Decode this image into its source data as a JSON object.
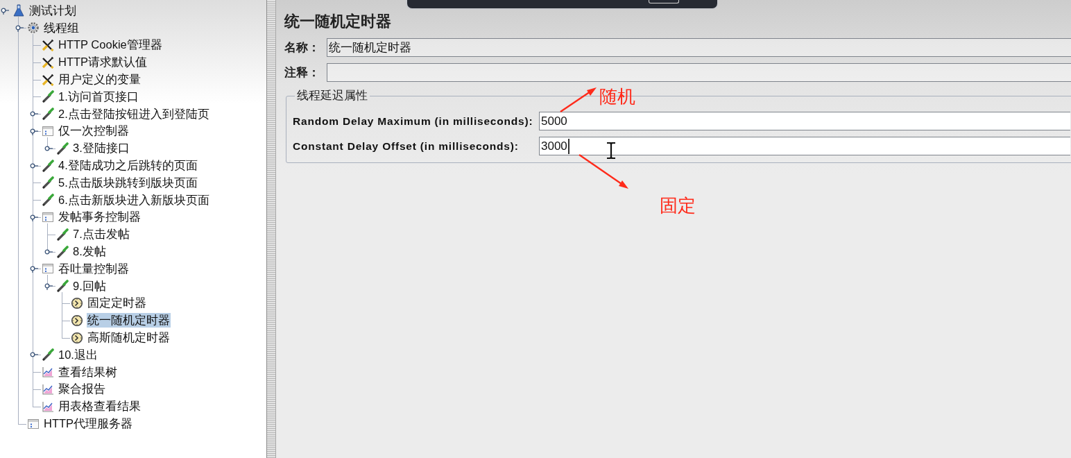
{
  "tree": [
    {
      "label": "测试计划",
      "kind": "test_plan",
      "selected": false,
      "expanded": true,
      "children": [
        {
          "label": "线程组",
          "kind": "thread_group",
          "selected": false,
          "expanded": true,
          "children": [
            {
              "label": "HTTP Cookie管理器",
              "kind": "config",
              "selected": false
            },
            {
              "label": "HTTP请求默认值",
              "kind": "config",
              "selected": false
            },
            {
              "label": "用户定义的变量",
              "kind": "config",
              "selected": false
            },
            {
              "label": "1.访问首页接口",
              "kind": "sampler",
              "selected": false
            },
            {
              "label": "2.点击登陆按钮进入到登陆页",
              "kind": "sampler",
              "selected": false,
              "expanded": false
            },
            {
              "label": "仅一次控制器",
              "kind": "controller",
              "selected": false,
              "expanded": true,
              "children": [
                {
                  "label": "3.登陆接口",
                  "kind": "sampler",
                  "selected": false,
                  "expanded": false
                }
              ]
            },
            {
              "label": "4.登陆成功之后跳转的页面",
              "kind": "sampler",
              "selected": false,
              "expanded": false
            },
            {
              "label": "5.点击版块跳转到版块页面",
              "kind": "sampler",
              "selected": false
            },
            {
              "label": "6.点击新版块进入新版块页面",
              "kind": "sampler",
              "selected": false
            },
            {
              "label": "发帖事务控制器",
              "kind": "controller",
              "selected": false,
              "expanded": true,
              "children": [
                {
                  "label": "7.点击发帖",
                  "kind": "sampler",
                  "selected": false
                },
                {
                  "label": "8.发帖",
                  "kind": "sampler",
                  "selected": false,
                  "expanded": false
                }
              ]
            },
            {
              "label": "吞吐量控制器",
              "kind": "controller",
              "selected": false,
              "expanded": true,
              "children": [
                {
                  "label": "9.回帖",
                  "kind": "sampler",
                  "selected": false,
                  "expanded": true,
                  "children": [
                    {
                      "label": "固定定时器",
                      "kind": "timer",
                      "selected": false
                    },
                    {
                      "label": "统一随机定时器",
                      "kind": "timer",
                      "selected": true
                    },
                    {
                      "label": "高斯随机定时器",
                      "kind": "timer",
                      "selected": false
                    }
                  ]
                }
              ]
            },
            {
              "label": "10.退出",
              "kind": "sampler",
              "selected": false,
              "expanded": false
            },
            {
              "label": "查看结果树",
              "kind": "listener",
              "selected": false
            },
            {
              "label": "聚合报告",
              "kind": "listener",
              "selected": false
            },
            {
              "label": "用表格查看结果",
              "kind": "listener",
              "selected": false
            }
          ]
        },
        {
          "label": "HTTP代理服务器",
          "kind": "proxy",
          "selected": false
        }
      ]
    }
  ],
  "editor": {
    "title": "统一随机定时器",
    "fields": [
      {
        "label": "名称：",
        "value": "统一随机定时器"
      },
      {
        "label": "注释："
      }
    ],
    "group": {
      "legend": "线程延迟属性",
      "rows": [
        {
          "label": "Random Delay Maximum (in milliseconds):",
          "value": "5000",
          "focused": false
        },
        {
          "label": "Constant Delay Offset (in milliseconds):",
          "value": "3000",
          "focused": true
        }
      ]
    }
  },
  "annotations": [
    {
      "text": "随机",
      "kind": "up"
    },
    {
      "text": "固定",
      "kind": "down"
    }
  ]
}
